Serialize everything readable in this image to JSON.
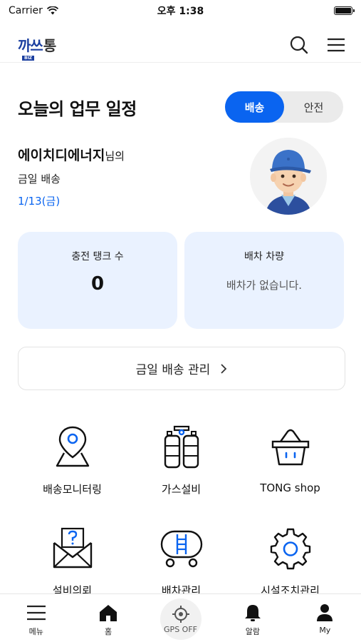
{
  "status_bar": {
    "carrier": "Carrier",
    "time": "오후 1:38"
  },
  "header": {
    "logo_primary": "까쓰",
    "logo_secondary": "통",
    "logo_badge": "BIZ"
  },
  "schedule": {
    "title": "오늘의 업무 일정",
    "tabs": [
      {
        "label": "배송",
        "active": true
      },
      {
        "label": "안전",
        "active": false
      }
    ],
    "company_name": "에이치디에너지",
    "company_suffix": "님의",
    "delivery_label": "금일 배송",
    "date": "1/13(금)"
  },
  "stats": {
    "tank_label": "충전 탱크 수",
    "tank_value": "0",
    "vehicle_label": "배차 차량",
    "vehicle_empty": "배차가 없습니다."
  },
  "manage_button": {
    "label": "금일 배송 관리"
  },
  "menu": [
    {
      "label": "배송모니터링",
      "icon": "map-pin-icon"
    },
    {
      "label": "가스설비",
      "icon": "gas-cylinders-icon"
    },
    {
      "label": "TONG shop",
      "icon": "basket-icon"
    },
    {
      "label": "설비의뢰",
      "icon": "envelope-question-icon"
    },
    {
      "label": "배차관리",
      "icon": "tank-truck-icon"
    },
    {
      "label": "시설조치관리",
      "icon": "gear-icon"
    }
  ],
  "tab_bar": [
    {
      "label": "메뉴",
      "icon": "hamburger-icon"
    },
    {
      "label": "홈",
      "icon": "home-icon"
    },
    {
      "label": "GPS OFF",
      "icon": "crosshair-icon"
    },
    {
      "label": "알람",
      "icon": "bell-icon"
    },
    {
      "label": "My",
      "icon": "person-icon"
    }
  ],
  "colors": {
    "accent": "#0a64f0",
    "card_bg": "#eaf2ff",
    "brand": "#1b3fa0"
  }
}
